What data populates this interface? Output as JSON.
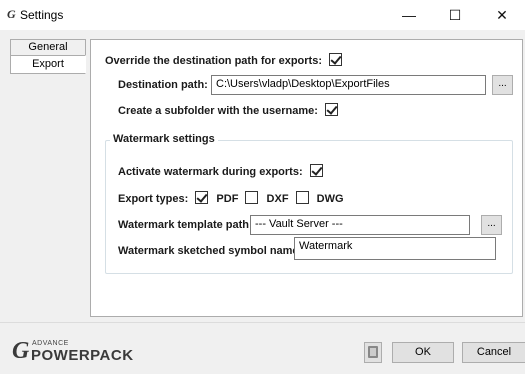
{
  "window": {
    "title": "Settings",
    "app_icon": "G",
    "minimize_glyph": "—",
    "maximize_glyph": "☐",
    "close_glyph": "✕"
  },
  "tabs": [
    {
      "label": "General",
      "selected": false
    },
    {
      "label": "Export",
      "selected": true
    }
  ],
  "export": {
    "override_label": "Override the destination path for exports:",
    "override_checked": true,
    "destination_label": "Destination path:",
    "destination_value": "C:\\Users\\vladp\\Desktop\\ExportFiles",
    "browse_label": "...",
    "subfolder_label": "Create a subfolder with the username:",
    "subfolder_checked": true
  },
  "watermark": {
    "group_title": "Watermark settings",
    "activate_label": "Activate watermark during exports:",
    "activate_checked": true,
    "types_label": "Export types:",
    "types": [
      {
        "label": "PDF",
        "checked": true
      },
      {
        "label": "DXF",
        "checked": false
      },
      {
        "label": "DWG",
        "checked": false
      }
    ],
    "template_label": "Watermark template path:",
    "template_value": "--- Vault Server ---",
    "template_browse_label": "...",
    "symbol_label": "Watermark sketched symbol name:",
    "symbol_value": "Watermark"
  },
  "footer": {
    "logo_small": "ADVANCE",
    "logo_large": "POWERPACK",
    "logo_mark": "G",
    "ok_label": "OK",
    "cancel_label": "Cancel"
  }
}
